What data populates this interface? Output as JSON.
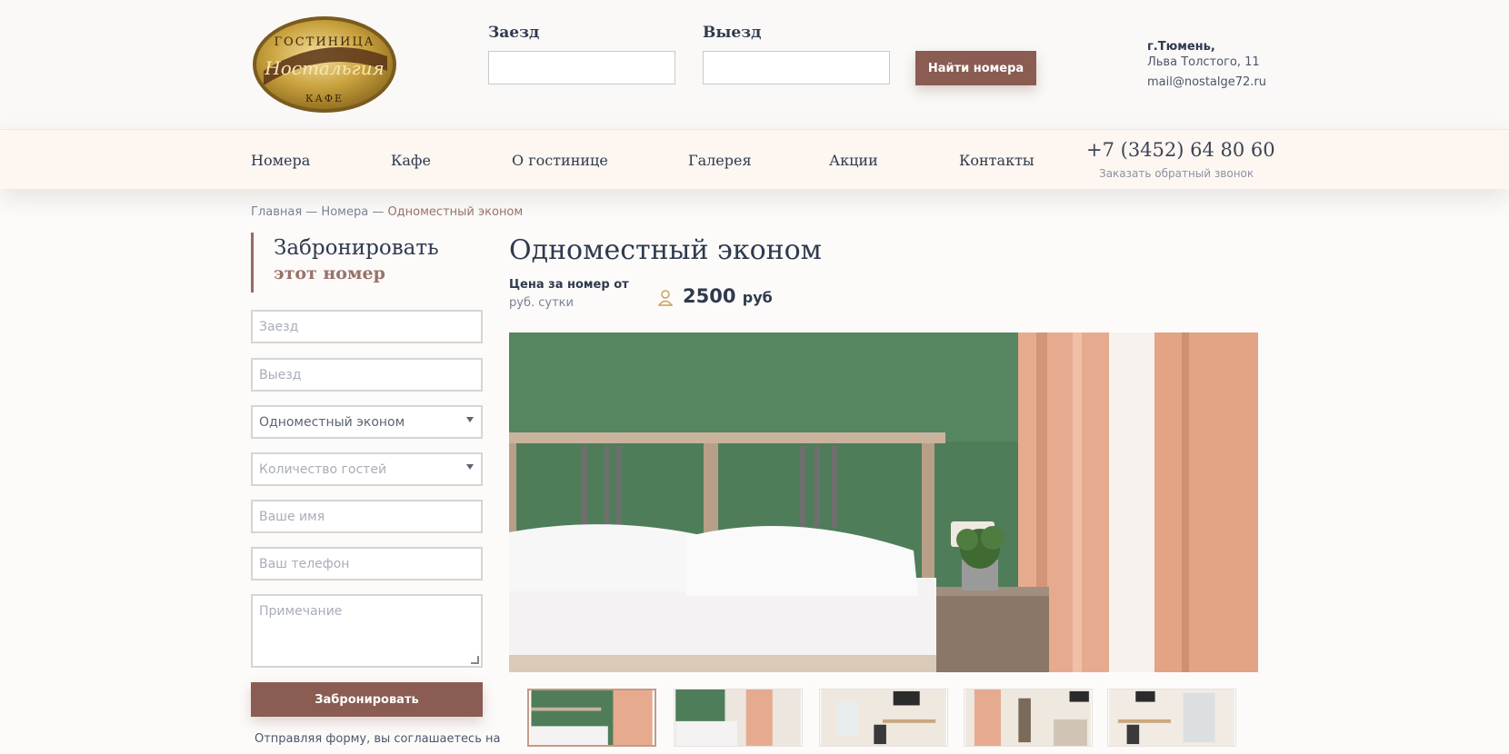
{
  "header": {
    "logo": {
      "top_text": "ГОСТИНИЦА",
      "name": "Ностальгия",
      "bottom_text": "КАФЕ"
    },
    "checkin_label": "Заезд",
    "checkout_label": "Выезд",
    "find_button": "Найти номера",
    "city": "г.Тюмень,",
    "street": "Льва Толстого, 11",
    "email": "mail@nostalge72.ru"
  },
  "nav": {
    "items": [
      "Номера",
      "Кафе",
      "О гостинице",
      "Галерея",
      "Акции",
      "Контакты"
    ],
    "phone": "+7 (3452) 64 80 60",
    "callback": "Заказать обратный звонок"
  },
  "breadcrumb": {
    "home": "Главная",
    "sep": " — ",
    "rooms": "Номера",
    "current": "Одноместный эконом"
  },
  "booking": {
    "title": "Забронировать",
    "subtitle": "этот номер",
    "checkin_placeholder": "Заезд",
    "checkout_placeholder": "Выезд",
    "room_type_value": "Одноместный эконом",
    "guests_placeholder": "Количество гостей",
    "name_placeholder": "Ваше имя",
    "phone_placeholder": "Ваш телефон",
    "note_placeholder": "Примечание",
    "submit": "Забронировать",
    "consent": "Отправляя форму, вы соглашаетесь на"
  },
  "room": {
    "title": "Одноместный эконом",
    "price_label": "Цена за номер от",
    "price_unit": "руб. сутки",
    "price_value": "2500",
    "price_currency": "руб"
  },
  "colors": {
    "accent": "#8a5c52",
    "text_dark": "#2f3a4c",
    "wall_green": "#4f7d5a"
  }
}
